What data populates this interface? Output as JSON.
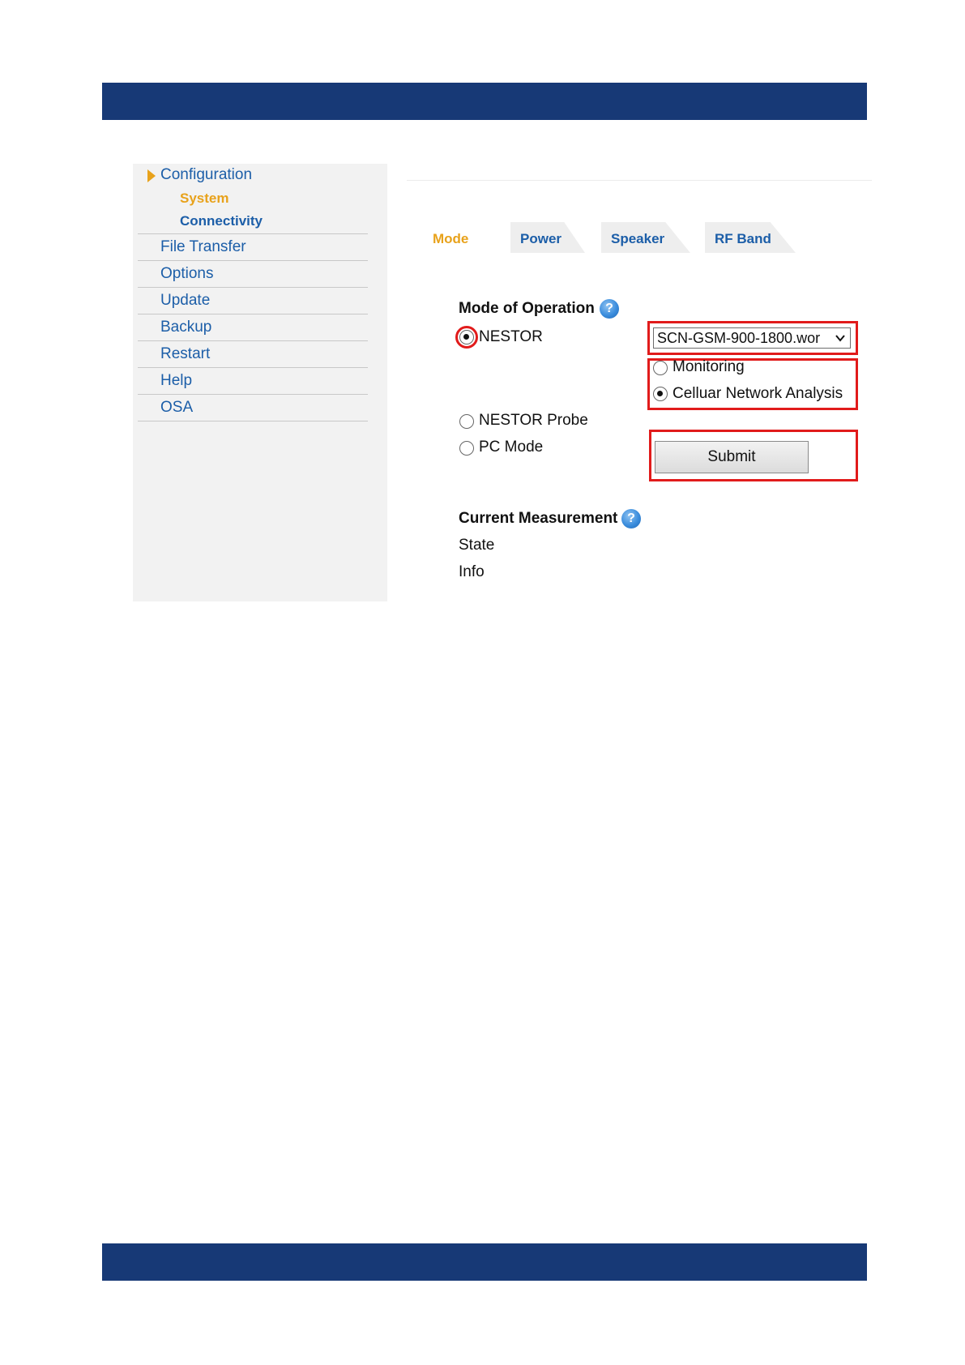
{
  "sidebar": {
    "configuration": {
      "label": "Configuration",
      "children": [
        {
          "label": "System",
          "active": true
        },
        {
          "label": "Connectivity",
          "active": false
        }
      ]
    },
    "items": [
      {
        "label": "File Transfer"
      },
      {
        "label": "Options"
      },
      {
        "label": "Update"
      },
      {
        "label": "Backup"
      },
      {
        "label": "Restart"
      },
      {
        "label": "Help"
      },
      {
        "label": "OSA"
      }
    ]
  },
  "tabs": [
    {
      "label": "Mode",
      "active": true
    },
    {
      "label": "Power",
      "active": false
    },
    {
      "label": "Speaker",
      "active": false
    },
    {
      "label": "RF Band",
      "active": false
    }
  ],
  "mode_of_operation": {
    "title": "Mode of Operation",
    "options": [
      {
        "label": "NESTOR",
        "checked": true
      },
      {
        "label": "NESTOR Probe",
        "checked": false
      },
      {
        "label": "PC Mode",
        "checked": false
      }
    ],
    "workspace_select": {
      "value": "SCN-GSM-900-1800.wor"
    },
    "sub_options": [
      {
        "label": "Monitoring",
        "checked": false
      },
      {
        "label": "Celluar Network Analysis",
        "checked": true
      }
    ],
    "submit_label": "Submit"
  },
  "current_measurement": {
    "title": "Current Measurement",
    "state_label": "State",
    "info_label": "Info"
  },
  "icons": {
    "help": "help-icon",
    "nav_arrow": "triangle-right-icon",
    "select_chevron": "chevron-down-icon"
  },
  "colors": {
    "banner": "#173976",
    "nav_link": "#1c5ea8",
    "nav_active": "#e8a21b",
    "highlight": "#e11b1b"
  }
}
